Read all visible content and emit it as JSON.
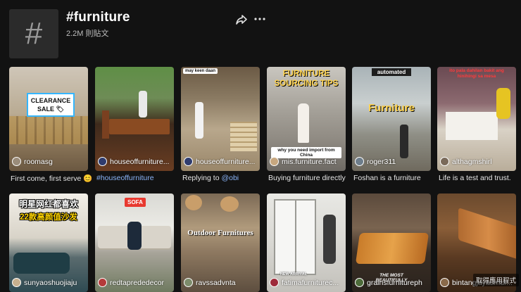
{
  "header": {
    "tag_title": "#furniture",
    "post_count": "2.2M 則貼文",
    "tag_symbol": "#",
    "share_icon": "share-icon",
    "more_icon": "more-icon"
  },
  "posts_row1": [
    {
      "username": "roomasg",
      "caption": "First come, first serve 😊",
      "overlay": "CLEARANCE SALE 🏷"
    },
    {
      "username": "houseoffurniture...",
      "caption": "#houseoffurniture"
    },
    {
      "username": "houseoffurniture...",
      "caption_prefix": "Replying to ",
      "caption_mention": "@obi",
      "overlay": "may keen daan"
    },
    {
      "username": "mis.furniture.fact",
      "caption": "Buying furniture directly",
      "overlay": "FURNITURE SOURCING TIPS",
      "overlay2": "why you need import from China"
    },
    {
      "username": "roger311",
      "caption": "Foshan is a furniture",
      "overlay": "automated",
      "overlay2": "Furniture"
    },
    {
      "username": "althagmshirl",
      "caption": "Life is a test and trust.",
      "overlay": "ito pala dahilan bakit ang hinihingi sa mesa"
    }
  ],
  "posts_row2": [
    {
      "username": "sunyaoshuojiaju",
      "overlay": "明星网红都喜欢",
      "overlay2": "22款高颜值沙发"
    },
    {
      "username": "redtaprededecor",
      "overlay": "SOFA"
    },
    {
      "username": "ravssadvnta",
      "overlay": "Outdoor Furnitures"
    },
    {
      "username": "fatimafurniturec...",
      "overlay": "NEW ARRIVAL"
    },
    {
      "username": "grainsfurnitureph",
      "overlay": "THE MOST BEAUTIFULLY"
    },
    {
      "username": "bintangjayaumur..."
    }
  ],
  "toast": {
    "text": "取得應用程式"
  }
}
